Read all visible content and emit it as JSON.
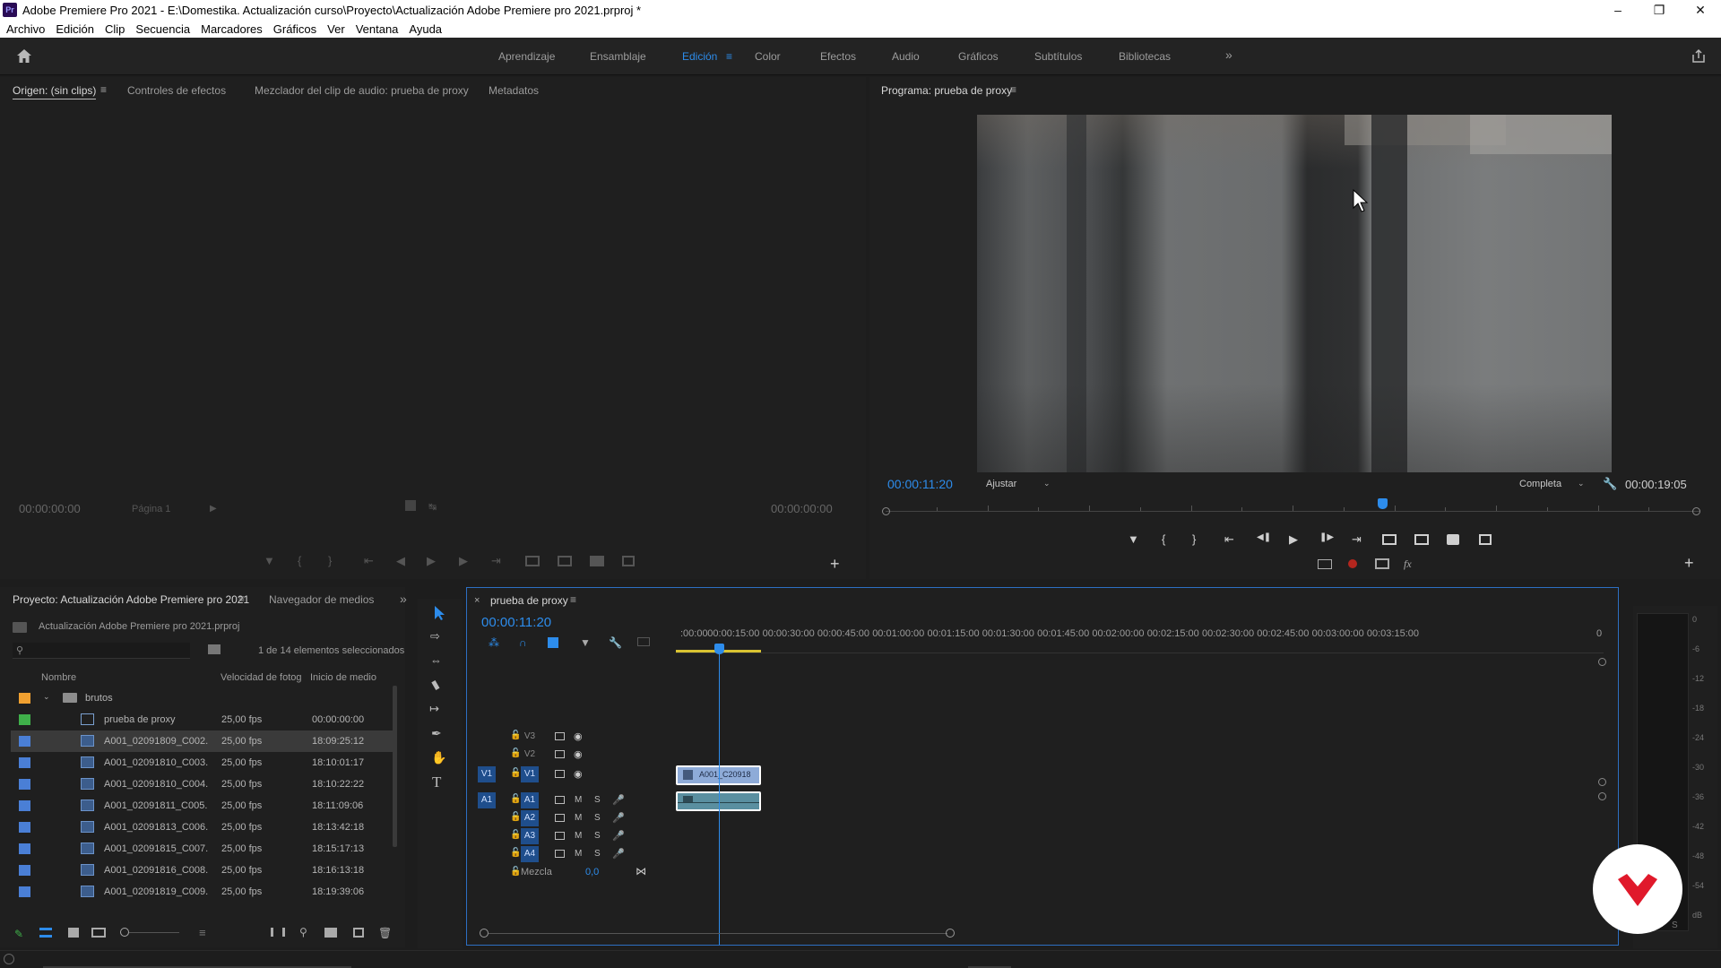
{
  "window": {
    "title": "Adobe Premiere Pro 2021 - E:\\Domestika. Actualización curso\\Proyecto\\Actualización Adobe Premiere pro 2021.prproj *",
    "app_badge": "Pr"
  },
  "menu": [
    "Archivo",
    "Edición",
    "Clip",
    "Secuencia",
    "Marcadores",
    "Gráficos",
    "Ver",
    "Ventana",
    "Ayuda"
  ],
  "workspaces": [
    "Aprendizaje",
    "Ensamblaje",
    "Edición",
    "Color",
    "Efectos",
    "Audio",
    "Gráficos",
    "Subtítulos",
    "Bibliotecas"
  ],
  "active_workspace": "Edición",
  "source_panel": {
    "tabs": [
      "Origen: (sin clips)",
      "Controles de efectos",
      "Mezclador del clip de audio: prueba de proxy",
      "Metadatos"
    ],
    "timecode_left": "00:00:00:00",
    "page": "Página 1",
    "timecode_right": "00:00:00:00"
  },
  "program_panel": {
    "tab": "Programa: prueba de proxy",
    "timecode": "00:00:11:20",
    "fit": "Ajustar",
    "quality": "Completa",
    "duration": "00:00:19:05",
    "playhead_fraction": 0.61
  },
  "project_panel": {
    "tabs": [
      "Proyecto: Actualización Adobe Premiere pro 2021",
      "Navegador de medios"
    ],
    "file": "Actualización Adobe Premiere pro 2021.prproj",
    "selection_info": "1 de 14 elementos seleccionados",
    "columns": [
      "Nombre",
      "Velocidad de fotog",
      "Inicio de medio"
    ],
    "folder": "brutos",
    "items": [
      {
        "name": "prueba de proxy",
        "fps": "25,00 fps",
        "start": "00:00:00:00",
        "color": "#3fb04a",
        "type": "sequence"
      },
      {
        "name": "A001_02091809_C002.",
        "fps": "25,00 fps",
        "start": "18:09:25:12",
        "color": "#4a7fd6",
        "type": "clip",
        "selected": true
      },
      {
        "name": "A001_02091810_C003.",
        "fps": "25,00 fps",
        "start": "18:10:01:17",
        "color": "#4a7fd6",
        "type": "clip"
      },
      {
        "name": "A001_02091810_C004.",
        "fps": "25,00 fps",
        "start": "18:10:22:22",
        "color": "#4a7fd6",
        "type": "clip"
      },
      {
        "name": "A001_02091811_C005.",
        "fps": "25,00 fps",
        "start": "18:11:09:06",
        "color": "#4a7fd6",
        "type": "clip"
      },
      {
        "name": "A001_02091813_C006.",
        "fps": "25,00 fps",
        "start": "18:13:42:18",
        "color": "#4a7fd6",
        "type": "clip"
      },
      {
        "name": "A001_02091815_C007.",
        "fps": "25,00 fps",
        "start": "18:15:17:13",
        "color": "#4a7fd6",
        "type": "clip"
      },
      {
        "name": "A001_02091816_C008.",
        "fps": "25,00 fps",
        "start": "18:16:13:18",
        "color": "#4a7fd6",
        "type": "clip"
      },
      {
        "name": "A001_02091819_C009.",
        "fps": "25,00 fps",
        "start": "18:19:39:06",
        "color": "#4a7fd6",
        "type": "clip"
      }
    ]
  },
  "timeline": {
    "close": "×",
    "tab": "prueba de proxy",
    "timecode": "00:00:11:20",
    "ruler": [
      ":00:00",
      "00:00:15:00",
      "00:00:30:00",
      "00:00:45:00",
      "00:01:00:00",
      "00:01:15:00",
      "00:01:30:00",
      "00:01:45:00",
      "00:02:00:00",
      "00:02:15:00",
      "00:02:30:00",
      "00:02:45:00",
      "00:03:00:00",
      "00:03:15:00",
      "0"
    ],
    "video_tracks": [
      "V3",
      "V2",
      "V1"
    ],
    "audio_tracks": [
      "A1",
      "A2",
      "A3",
      "A4"
    ],
    "source_v": "V1",
    "source_a": "A1",
    "mute": "M",
    "solo": "S",
    "mix_label": "Mezcla",
    "mix_value": "0,0",
    "clip_name": "A001_C20918"
  },
  "meter_scale": [
    "0",
    "-6",
    "-12",
    "-18",
    "-24",
    "-30",
    "-36",
    "-42",
    "-48",
    "-54",
    "dB"
  ],
  "meter_solo": "S"
}
